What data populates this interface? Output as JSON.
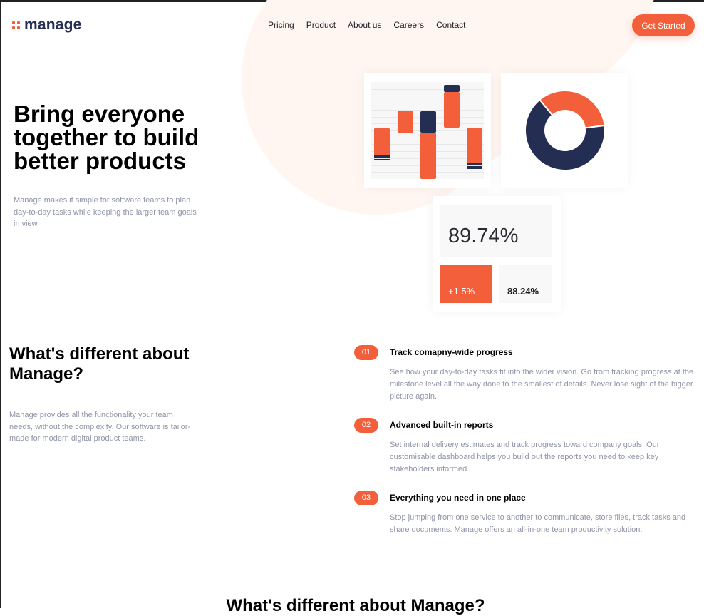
{
  "brand": {
    "name": "manage",
    "accent": "#f25f3a",
    "navy": "#242d52"
  },
  "nav": {
    "links": [
      "Pricing",
      "Product",
      "About us",
      "Careers",
      "Contact"
    ],
    "cta_label": "Get Started"
  },
  "hero": {
    "title": "Bring everyone together to build better products",
    "description": "Manage makes it simple for software teams to plan day-to-day tasks while keeping the larger team goals in view."
  },
  "stats": {
    "main": "89.74%",
    "change": "+1.5%",
    "secondary": "88.24%"
  },
  "chart_data": [
    {
      "type": "bar",
      "categories": [
        "1",
        "2",
        "3",
        "4",
        "5"
      ],
      "series": [
        {
          "color": "#f25f3a",
          "floating_ranges": [
            [
              0.24,
              0.52
            ],
            [
              0.47,
              0.7
            ],
            [
              0,
              0.48
            ],
            [
              0.53,
              0.9
            ],
            [
              0.16,
              0.52
            ]
          ]
        },
        {
          "color": "#242d52",
          "floating_ranges": [
            [
              0.24,
              0.52
            ],
            [
              0.47,
              0.7
            ],
            [
              0.48,
              0.7
            ],
            [
              0.9,
              0.97
            ],
            [
              0.16,
              0.52
            ]
          ]
        }
      ]
    },
    {
      "type": "pie",
      "donut": true,
      "slices": [
        {
          "value": 34,
          "color": "#f25f3a"
        },
        {
          "value": 66,
          "color": "#242d52"
        }
      ]
    }
  ],
  "differences": {
    "title": "What's different about Manage?",
    "description": "Manage provides all the functionality your team needs, without the complexity. Our software is tailor-made for modern digital product teams.",
    "features": [
      {
        "number": "01",
        "title": "Track comapny-wide progress",
        "description": "See how your day-to-day tasks fit into the wider vision. Go from tracking progress at the milestone level all the way done to the smallest of details. Never lose sight of the bigger picture again."
      },
      {
        "number": "02",
        "title": "Advanced built-in reports",
        "description": "Set internal delivery estimates and track progress toward company goals. Our customisable dashboard helps you build out the reports you need to keep key stakeholders informed."
      },
      {
        "number": "03",
        "title": "Everything you need in one place",
        "description": "Stop jumping from one service to another to communicate, store files, track tasks and share documents. Manage offers an all-in-one team productivity solution."
      }
    ]
  },
  "bottom_section": {
    "title": "What's different about Manage?"
  }
}
